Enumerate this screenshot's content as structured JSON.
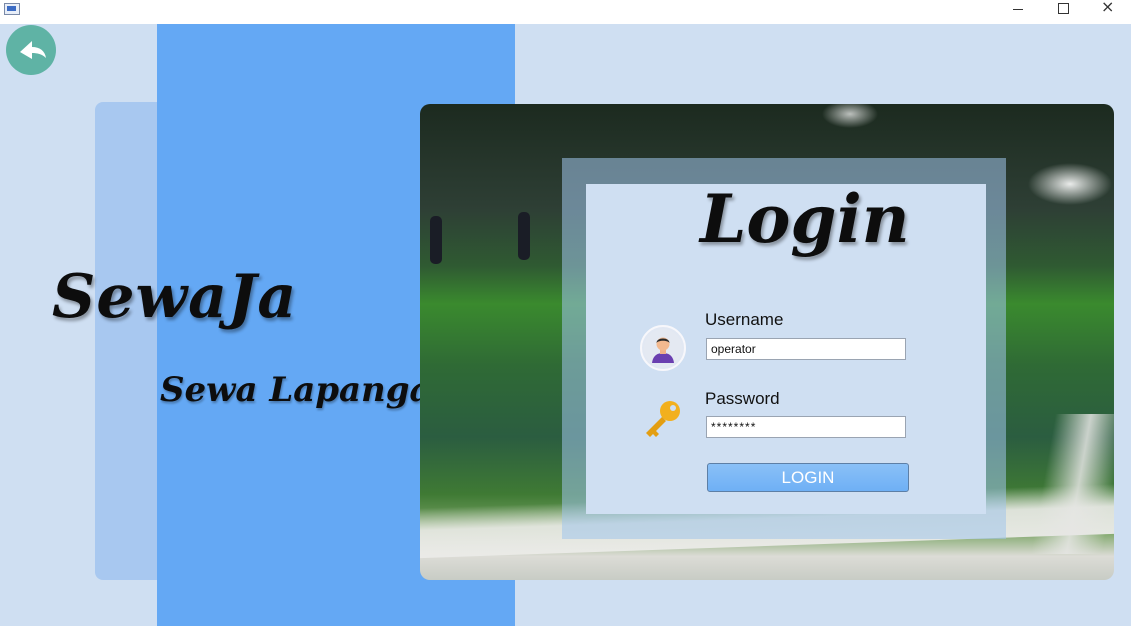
{
  "window": {
    "controls": {
      "minimize": "minimize",
      "maximize": "maximize",
      "close": "×"
    }
  },
  "brand": {
    "title": "SewaJa",
    "subtitle": "Sewa Lapangan"
  },
  "login": {
    "heading": "Login",
    "username_label": "Username",
    "username_value": "operator",
    "password_label": "Password",
    "password_value": "********",
    "button_label": "LOGIN"
  },
  "icons": {
    "back": "back-arrow-icon",
    "user": "user-avatar-icon",
    "key": "key-icon"
  },
  "colors": {
    "background": "#cfdff2",
    "strip": "#64a8f4",
    "button": "#6fb0f5",
    "back_button": "#5fb3a5",
    "key": "#f2b01e"
  }
}
